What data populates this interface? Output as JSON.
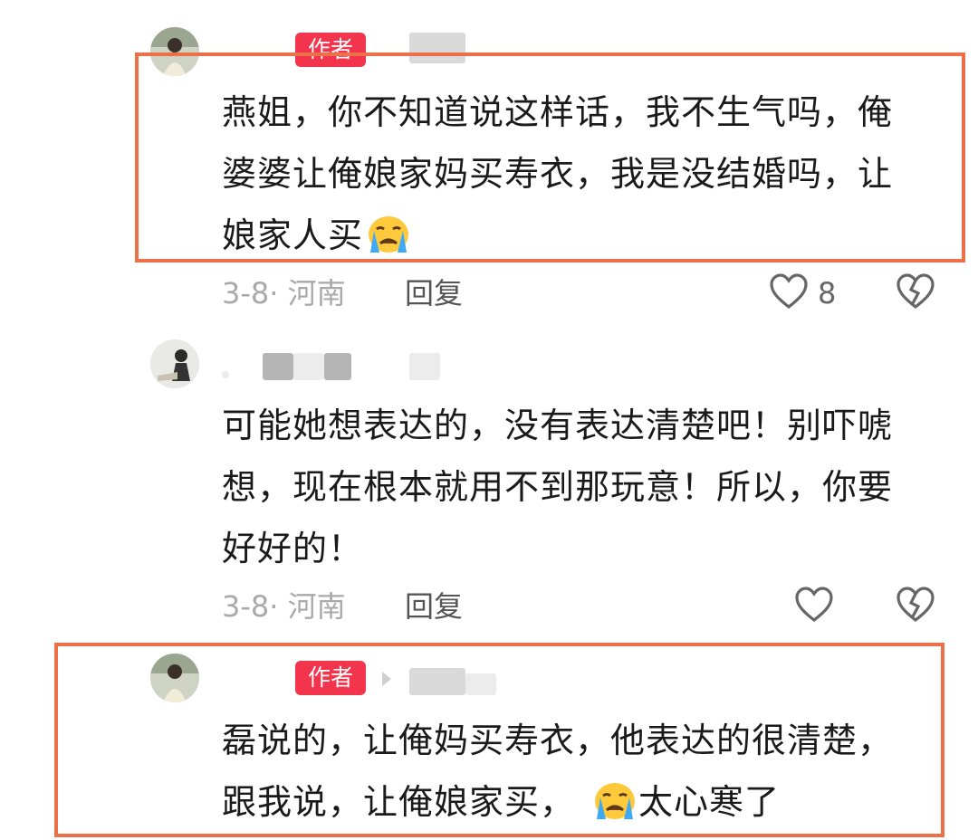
{
  "comments": [
    {
      "badge": "作者",
      "text_lines": [
        "燕姐，你不知道说这样话，我不生气吗，俺",
        "婆婆让俺娘家妈买寿衣，我是没结婚吗，让",
        "娘家人买"
      ],
      "date_location": "3-8· 河南",
      "reply_label": "回复",
      "like_count": "8"
    },
    {
      "text_lines": [
        "可能她想表达的，没有表达清楚吧！别吓唬",
        "想，现在根本就用不到那玩意！所以，你要",
        "好好的！"
      ],
      "date_location": "3-8· 河南",
      "reply_label": "回复"
    },
    {
      "badge": "作者",
      "text_lines": [
        "磊说的，让俺妈买寿衣，他表达的很清楚，",
        "跟我说，让俺娘家买，",
        "太心寒了"
      ]
    }
  ],
  "icons": {
    "like": "heart-outline-icon",
    "dislike": "broken-heart-icon",
    "emoji": "crying-face-emoji"
  },
  "colors": {
    "badge_bg": "#f2354c",
    "highlight_border": "#ee7049",
    "meta_text": "#a9a9a9"
  }
}
